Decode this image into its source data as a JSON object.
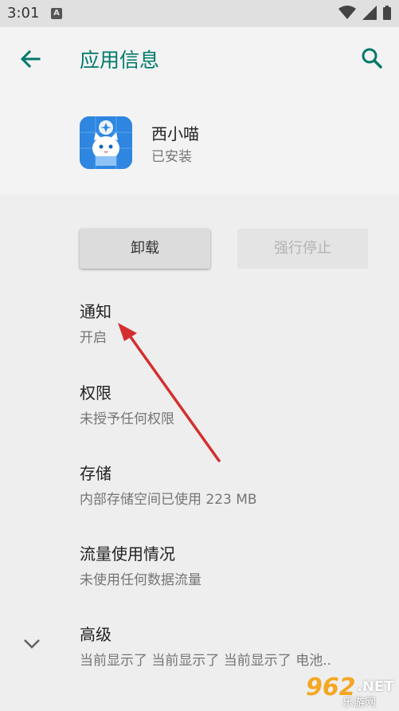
{
  "status_bar": {
    "time": "3:01",
    "notification_letter": "A"
  },
  "header": {
    "title": "应用信息"
  },
  "app": {
    "name": "西小喵",
    "install_status": "已安装"
  },
  "buttons": {
    "uninstall": "卸载",
    "force_stop": "强行停止"
  },
  "settings": [
    {
      "title": "通知",
      "subtitle": "开启"
    },
    {
      "title": "权限",
      "subtitle": "未授予任何权限"
    },
    {
      "title": "存储",
      "subtitle": "内部存储空间已使用 223 MB"
    },
    {
      "title": "流量使用情况",
      "subtitle": "未使用任何数据流量"
    },
    {
      "title": "高级",
      "subtitle": "当前显示了 当前显示了 当前显示了 电池.."
    }
  ],
  "watermark": {
    "number": "962",
    "domain": ".NET",
    "cn": "乐游网"
  },
  "colors": {
    "accent": "#00796b",
    "annotation_arrow": "#d32f2f"
  }
}
